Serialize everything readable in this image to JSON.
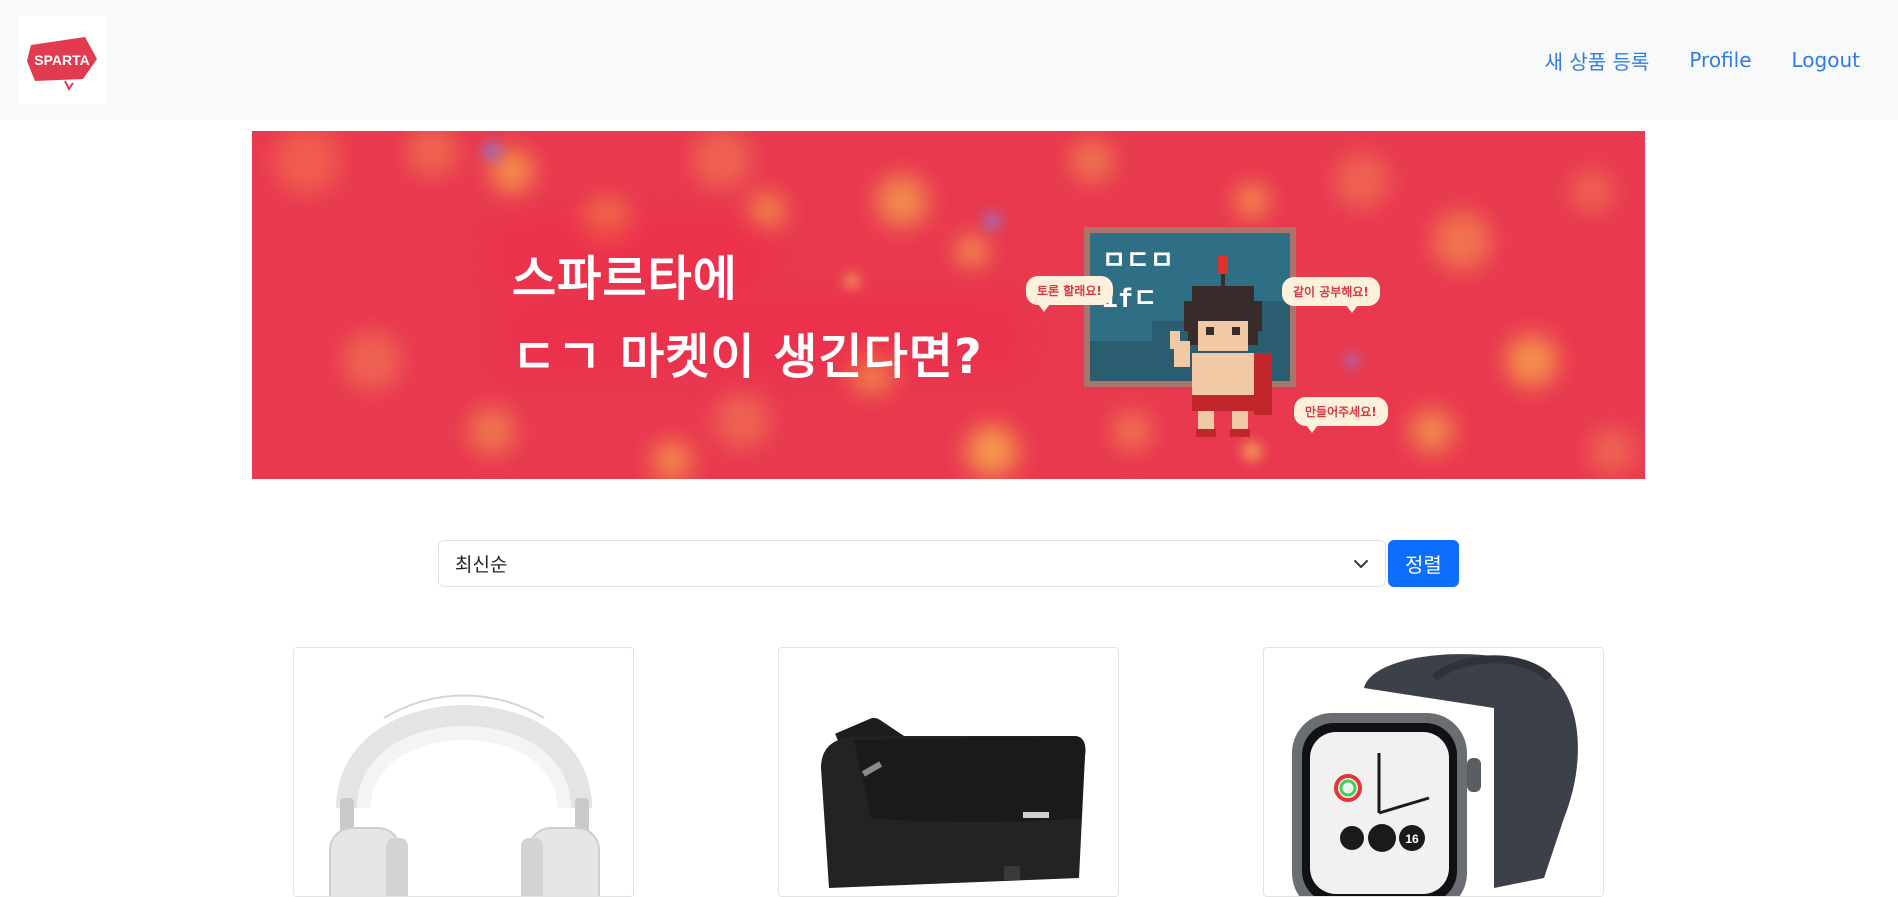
{
  "header": {
    "logo_text": "SPARTA",
    "nav": [
      {
        "label": "새 상품 등록"
      },
      {
        "label": "Profile"
      },
      {
        "label": "Logout"
      }
    ]
  },
  "banner": {
    "line1": "스파르타에",
    "line2": "ㄷㄱ 마켓이 생긴다면?",
    "bubbles": [
      "같이 공부해요!",
      "토론 할래요!",
      "만들어주세요!"
    ],
    "board_text": [
      "ㅁㄷㅁ",
      "ifㄷ"
    ]
  },
  "sort": {
    "selected": "최신순",
    "button_label": "정렬"
  },
  "products": [
    {
      "icon": "headphones-image"
    },
    {
      "icon": "messenger-bag-image"
    },
    {
      "icon": "smartwatch-image",
      "watch_readout": "16"
    }
  ],
  "colors": {
    "accent": "#0d6efd",
    "nav_link": "#2f7de1",
    "banner_bg": "#e8394f",
    "navbar_bg": "#f8f9fa"
  }
}
